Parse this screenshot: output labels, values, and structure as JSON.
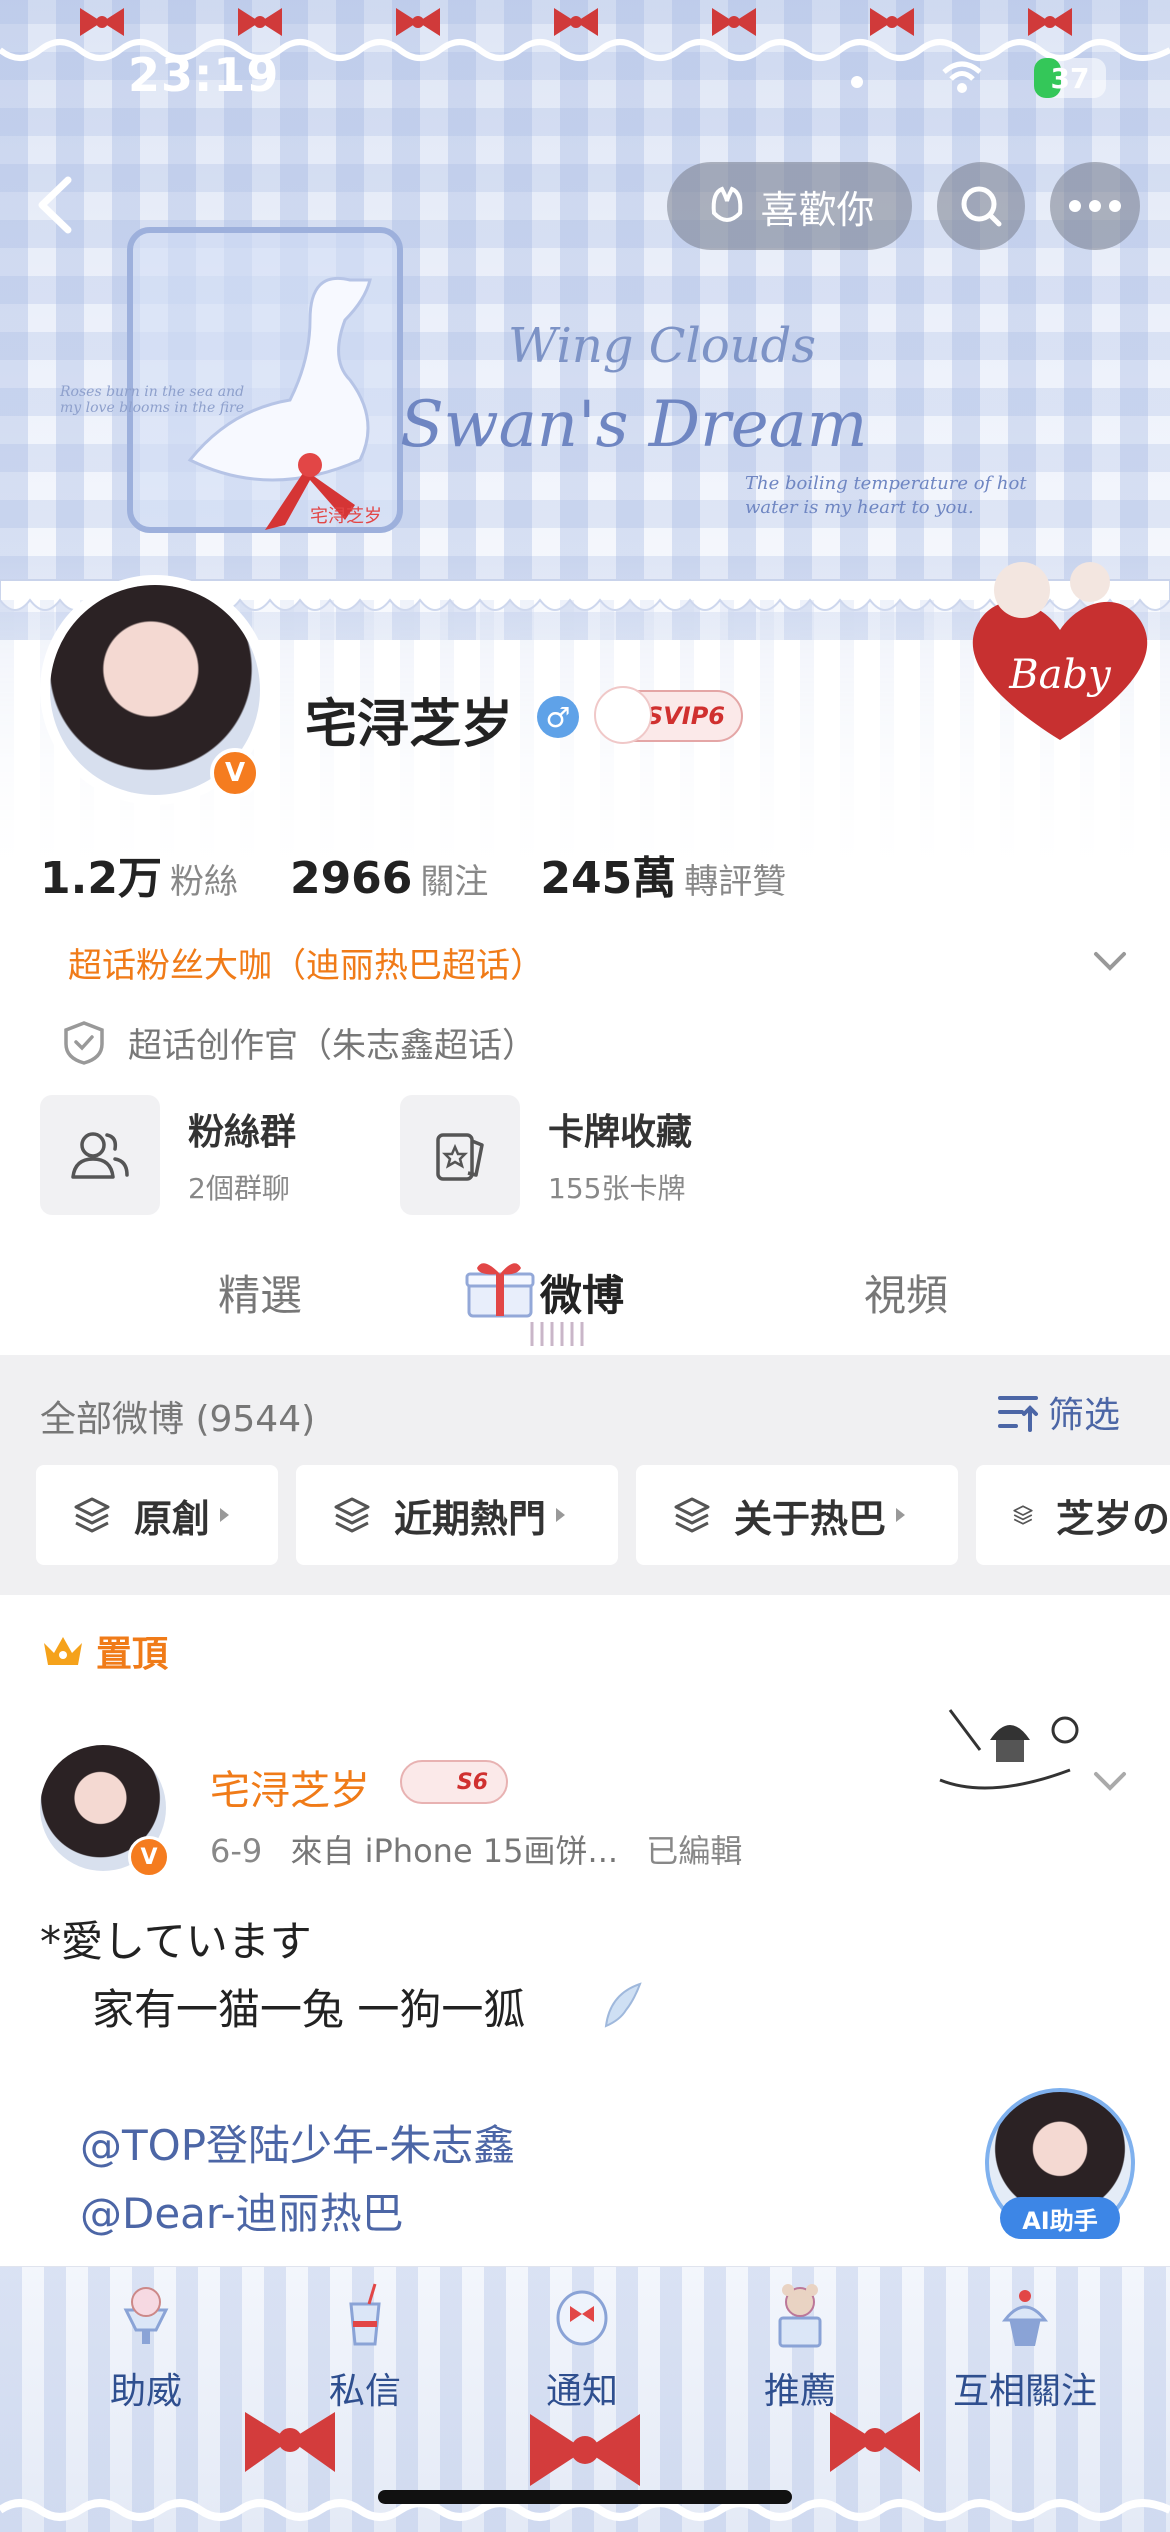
{
  "status_bar": {
    "time": "23:19",
    "battery": "37",
    "battery_level": 0.37
  },
  "header": {
    "like_label": "喜歡你",
    "banner_title_line1": "Wing Clouds",
    "banner_title_line2": "Swan's Dream",
    "banner_caption_left": "Roses burn in the sea and my love blooms in the fire",
    "banner_caption_right": "The boiling temperature of hot water is my heart to you.",
    "banner_swan_label": "宅浔芝岁"
  },
  "profile": {
    "name": "宅浔芝岁",
    "gender_symbol": "♂",
    "svip_label": "SVIP6",
    "verified_symbol": "V",
    "stats": [
      {
        "value": "1.2万",
        "label": "粉絲"
      },
      {
        "value": "2966",
        "label": "關注"
      },
      {
        "value": "245萬",
        "label": "轉評贊"
      }
    ],
    "super_fan": "超话粉丝大咖（迪丽热巴超话）",
    "creator": "超话创作官（朱志鑫超话）",
    "cards": [
      {
        "title": "粉絲群",
        "subtitle": "2個群聊"
      },
      {
        "title": "卡牌收藏",
        "subtitle": "155张卡牌"
      }
    ]
  },
  "tabs": [
    {
      "label": "精選"
    },
    {
      "label": "微博"
    },
    {
      "label": "視頻"
    }
  ],
  "feed": {
    "all_label": "全部微博 (9544)",
    "filter_label": "筛选",
    "chips": [
      {
        "label": "原創"
      },
      {
        "label": "近期熱門"
      },
      {
        "label": "关于热巴"
      },
      {
        "label": "芝岁の"
      }
    ]
  },
  "post": {
    "pinned_label": "置頂",
    "author": "宅浔芝岁",
    "badge": "S6",
    "date": "6-9",
    "source": "來自 iPhone 15画饼...",
    "edited": "已編輯",
    "lines": [
      "*愛しています",
      "家有一猫一兔  一狗一狐"
    ],
    "mentions": [
      "@TOP登陆少年-朱志鑫",
      "@Dear-迪丽热巴"
    ],
    "ai_label": "AI助手"
  },
  "bottom_nav": [
    {
      "label": "助威"
    },
    {
      "label": "私信"
    },
    {
      "label": "通知"
    },
    {
      "label": "推薦"
    },
    {
      "label": "互相關注"
    }
  ],
  "colors": {
    "accent_orange": "#f07b18",
    "link_blue": "#4c66a6",
    "banner_blue": "#6f86c2"
  }
}
